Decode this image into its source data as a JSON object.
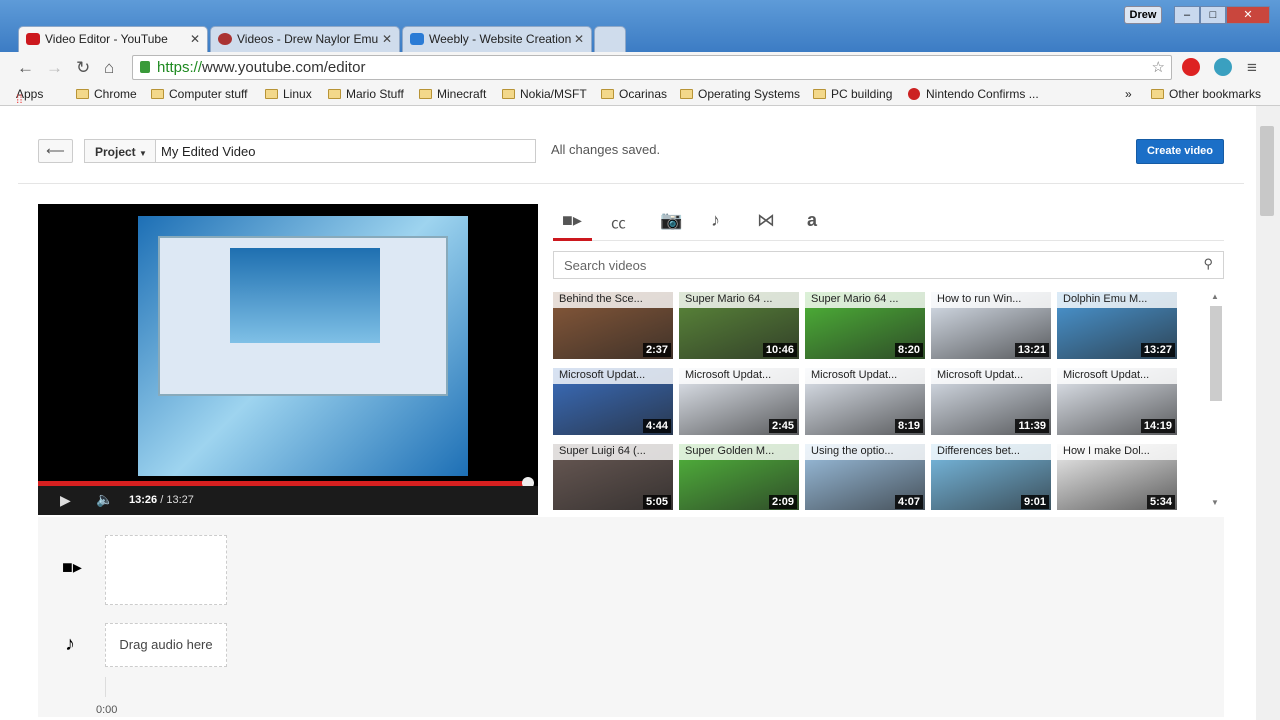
{
  "browser": {
    "tabs": [
      {
        "label": "Video Editor - YouTube",
        "color": "#cc181e"
      },
      {
        "label": "Videos - Drew Naylor Emu",
        "color": "#a33"
      },
      {
        "label": "Weebly - Website Creation",
        "color": "#2a7bd5"
      }
    ],
    "user": "Drew",
    "url_scheme": "https://",
    "url_rest": "www.youtube.com/editor",
    "bookmarks": [
      "Apps",
      "Chrome",
      "Computer stuff",
      "Linux",
      "Mario Stuff",
      "Minecraft",
      "Nokia/MSFT",
      "Ocarinas",
      "Operating Systems",
      "PC building",
      "Nintendo Confirms ...",
      "Other bookmarks"
    ],
    "overflow": "»"
  },
  "editor": {
    "project_label": "Project",
    "title_value": "My Edited Video",
    "status": "All changes saved.",
    "create_label": "Create video",
    "player": {
      "current": "13:26",
      "sep": "/",
      "duration": "13:27",
      "progress": 0.999
    },
    "media_tabs": [
      "video",
      "captions",
      "photo",
      "music",
      "transitions",
      "text"
    ],
    "search_placeholder": "Search videos",
    "videos": [
      {
        "title": "Behind the Sce...",
        "duration": "2:37",
        "bg": "#8a5a3a"
      },
      {
        "title": "Super Mario 64 ...",
        "duration": "10:46",
        "bg": "#5c8a3a"
      },
      {
        "title": "Super Mario 64 ...",
        "duration": "8:20",
        "bg": "#4fb838"
      },
      {
        "title": "How to run Win...",
        "duration": "13:21",
        "bg": "#dfe7f2"
      },
      {
        "title": "Dolphin Emu M...",
        "duration": "13:27",
        "bg": "#4b9ad8"
      },
      {
        "title": "Microsoft Updat...",
        "duration": "4:44",
        "bg": "#3b6fc0"
      },
      {
        "title": "Microsoft Updat...",
        "duration": "2:45",
        "bg": "#e8edf5"
      },
      {
        "title": "Microsoft Updat...",
        "duration": "8:19",
        "bg": "#e4eaf3"
      },
      {
        "title": "Microsoft Updat...",
        "duration": "11:39",
        "bg": "#dfe6f0"
      },
      {
        "title": "Microsoft Updat...",
        "duration": "14:19",
        "bg": "#e8edf5"
      },
      {
        "title": "Super Luigi 64 (...",
        "duration": "5:05",
        "bg": "#6a5a55"
      },
      {
        "title": "Super Golden M...",
        "duration": "2:09",
        "bg": "#52b83c"
      },
      {
        "title": "Using the optio...",
        "duration": "4:07",
        "bg": "#9fc4e4"
      },
      {
        "title": "Differences bet...",
        "duration": "9:01",
        "bg": "#7bc0e8"
      },
      {
        "title": "How I make Dol...",
        "duration": "5:34",
        "bg": "#f0f0f0"
      }
    ],
    "timeline": {
      "audio_hint": "Drag audio here",
      "time": "0:00"
    }
  }
}
